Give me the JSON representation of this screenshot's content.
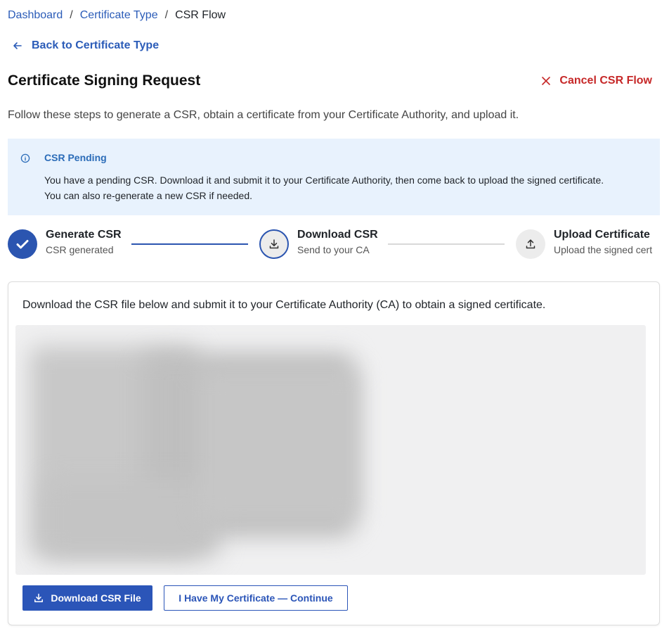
{
  "breadcrumb": {
    "items": [
      {
        "label": "Dashboard"
      },
      {
        "label": "Certificate Type"
      },
      {
        "label": "CSR Flow"
      }
    ],
    "separator": "/"
  },
  "back_link": {
    "label": "Back to Certificate Type"
  },
  "header": {
    "title": "Certificate Signing Request",
    "cancel_label": "Cancel CSR Flow",
    "subtitle": "Follow these steps to generate a CSR, obtain a certificate from your Certificate Authority, and upload it."
  },
  "alert": {
    "title": "CSR Pending",
    "line1": "You have a pending CSR. Download it and submit it to your Certificate Authority, then come back to upload the signed certificate.",
    "line2": "You can also re-generate a new CSR if needed."
  },
  "steps": [
    {
      "title": "Generate CSR",
      "subtitle": "CSR generated",
      "status": "done",
      "icon": "check-icon"
    },
    {
      "title": "Download CSR",
      "subtitle": "Send to your CA",
      "status": "active",
      "icon": "download-icon"
    },
    {
      "title": "Upload Certificate",
      "subtitle": "Upload the signed cert",
      "status": "pending",
      "icon": "upload-icon"
    }
  ],
  "card": {
    "instruction": "Download the CSR file below and submit it to your Certificate Authority (CA) to obtain a signed certificate.",
    "download_label": "Download CSR File",
    "continue_label": "I Have My Certificate — Continue"
  },
  "colors": {
    "accent": "#2b55b8",
    "danger": "#c62828",
    "info_bg": "#e8f2fd"
  }
}
